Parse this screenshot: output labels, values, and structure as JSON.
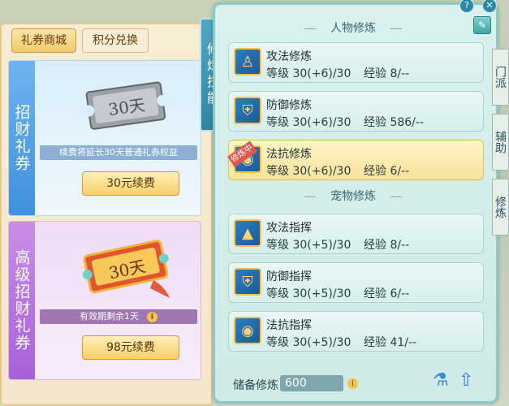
{
  "shop": {
    "tabs": [
      "礼券商城",
      "积分兑换"
    ],
    "cards": [
      {
        "side_title": "招财礼券",
        "ticket_text": "30天",
        "info": "续费将延长30天普通礼券权益",
        "button": "30元续费"
      },
      {
        "side_title": "高级招财礼券",
        "ticket_text": "30天",
        "info": "有效期剩余1天",
        "button": "98元续费"
      }
    ]
  },
  "skill_panel": {
    "side_tab": "修炼技能",
    "section_person": "人物修炼",
    "section_pet": "宠物修炼",
    "person_skills": [
      {
        "name": "攻法修炼",
        "level": "等级 30(+6)/30",
        "exp": "经验 8/--"
      },
      {
        "name": "防御修炼",
        "level": "等级 30(+6)/30",
        "exp": "经验 586/--"
      },
      {
        "name": "法抗修炼",
        "level": "等级 30(+6)/30",
        "exp": "经验 6/--",
        "badge": "修炼中"
      }
    ],
    "pet_skills": [
      {
        "name": "攻法指挥",
        "level": "等级 30(+5)/30",
        "exp": "经验 8/--"
      },
      {
        "name": "防御指挥",
        "level": "等级 30(+5)/30",
        "exp": "经验 6/--"
      },
      {
        "name": "法抗指挥",
        "level": "等级 30(+5)/30",
        "exp": "经验 41/--"
      }
    ],
    "reserve_label": "储备修炼",
    "reserve_value": "600"
  },
  "right_tabs": [
    "门派",
    "辅助",
    "修炼"
  ],
  "accent": "#8bc8c7"
}
